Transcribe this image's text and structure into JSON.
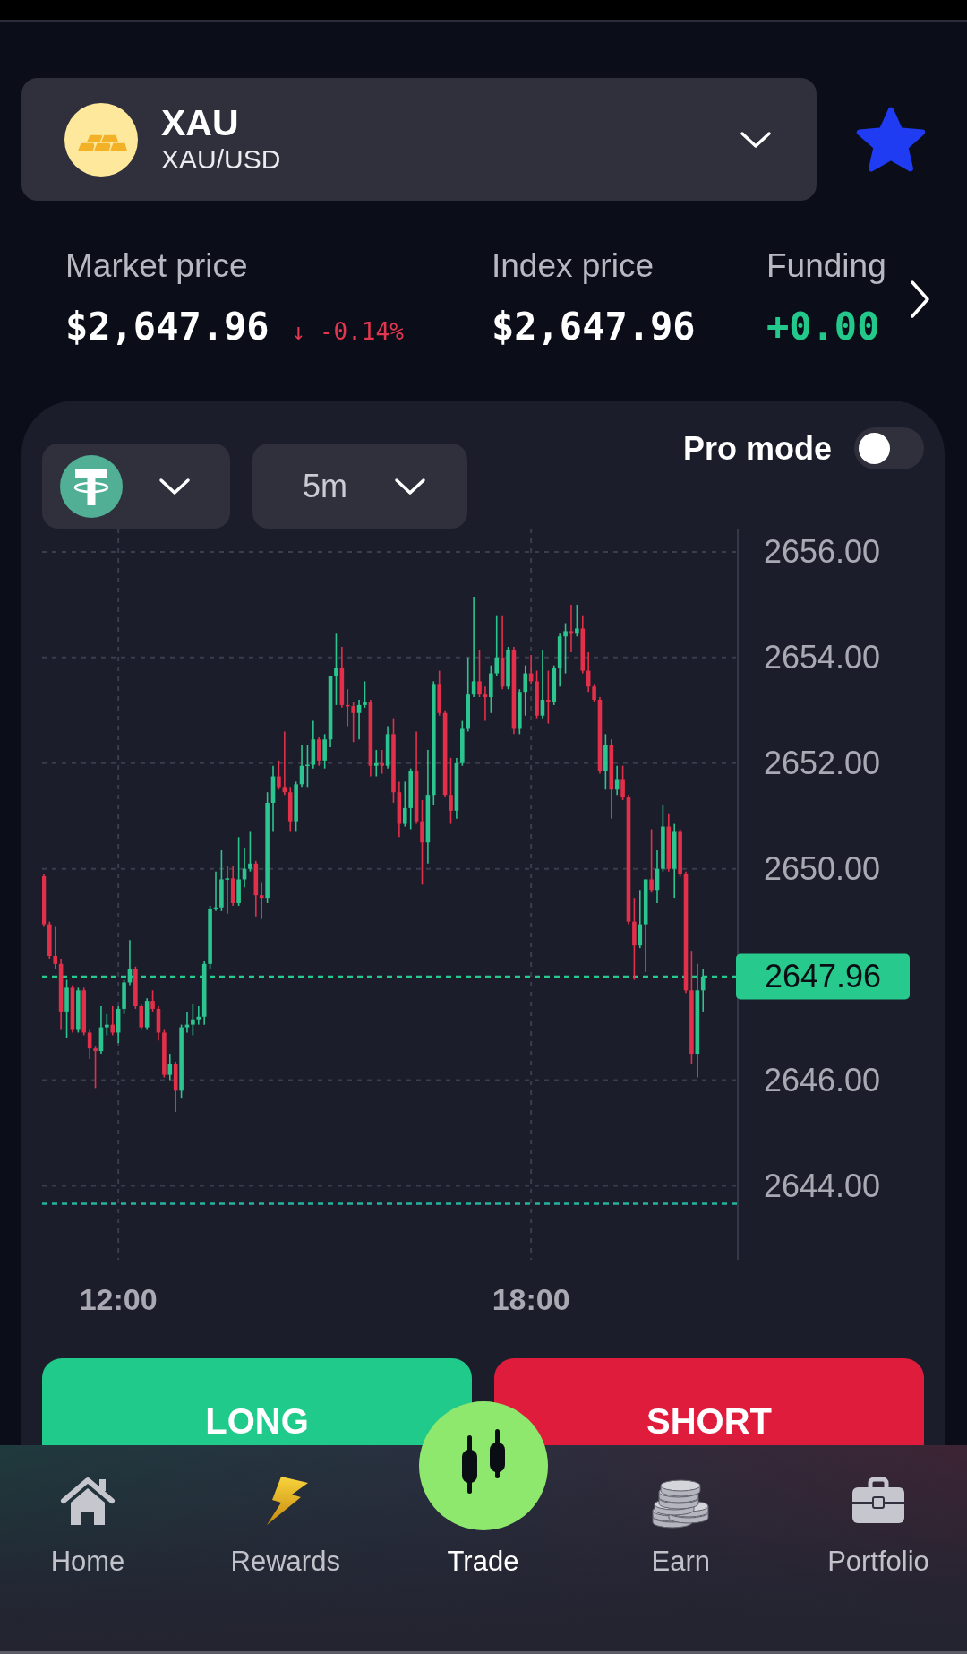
{
  "favorite": true,
  "asset_selector": {
    "symbol": "XAU",
    "pair": "XAU/USD"
  },
  "stats": [
    {
      "label": "Market price",
      "value": "$2,647.96",
      "value_positive": false,
      "change": "↓ -0.14%",
      "change_negative": true
    },
    {
      "label": "Index price",
      "value": "$2,647.96",
      "value_positive": false
    },
    {
      "label": "Funding",
      "value": "+0.00",
      "value_positive": true
    }
  ],
  "chart_panel": {
    "timeframe": "5m",
    "pro_mode": {
      "label": "Pro mode",
      "on": false
    },
    "chart_data": {
      "type": "candlestick",
      "grid": true,
      "xlim": [
        653.5,
        1259.5
      ],
      "ylim": [
        2642.6,
        2656.44
      ],
      "xticks": [
        {
          "value": 720,
          "label": "12:00"
        },
        {
          "value": 1080,
          "label": "18:00"
        }
      ],
      "yticks": [
        {
          "value": 2656,
          "label": "2656.00"
        },
        {
          "value": 2654,
          "label": "2654.00"
        },
        {
          "value": 2652,
          "label": "2652.00"
        },
        {
          "value": 2650,
          "label": "2650.00"
        },
        {
          "value": 2646,
          "label": "2646.00"
        },
        {
          "value": 2644,
          "label": "2644.00"
        }
      ],
      "x": [
        655,
        660,
        665,
        670,
        675,
        680,
        685,
        690,
        695,
        700,
        705,
        710,
        715,
        720,
        725,
        730,
        735,
        740,
        745,
        750,
        755,
        760,
        765,
        770,
        775,
        780,
        785,
        790,
        795,
        800,
        805,
        810,
        815,
        820,
        825,
        830,
        835,
        840,
        845,
        850,
        855,
        860,
        865,
        870,
        875,
        880,
        885,
        890,
        895,
        900,
        905,
        910,
        915,
        920,
        925,
        930,
        935,
        940,
        945,
        950,
        955,
        960,
        965,
        970,
        975,
        980,
        985,
        990,
        995,
        1000,
        1005,
        1010,
        1015,
        1020,
        1025,
        1030,
        1035,
        1040,
        1045,
        1050,
        1055,
        1060,
        1065,
        1070,
        1075,
        1080,
        1085,
        1090,
        1095,
        1100,
        1105,
        1110,
        1115,
        1120,
        1125,
        1130,
        1135,
        1140,
        1145,
        1150,
        1155,
        1160,
        1165,
        1170,
        1175,
        1180,
        1185,
        1190,
        1195,
        1200,
        1205,
        1210,
        1215,
        1220,
        1225,
        1230
      ],
      "ohlc": [
        [
          2649.86,
          2649.9,
          2648.9,
          2648.95
        ],
        [
          2648.95,
          2649.0,
          2648.3,
          2648.35
        ],
        [
          2648.35,
          2648.9,
          2648.1,
          2648.2
        ],
        [
          2648.2,
          2648.3,
          2646.95,
          2647.3
        ],
        [
          2647.3,
          2647.9,
          2646.8,
          2647.75
        ],
        [
          2647.75,
          2647.8,
          2646.9,
          2646.95
        ],
        [
          2646.95,
          2647.75,
          2646.9,
          2647.7
        ],
        [
          2647.7,
          2647.75,
          2646.85,
          2646.9
        ],
        [
          2646.9,
          2646.95,
          2646.4,
          2646.6
        ],
        [
          2646.6,
          2646.65,
          2645.85,
          2646.55
        ],
        [
          2646.55,
          2647.4,
          2646.5,
          2647.0
        ],
        [
          2647.0,
          2647.25,
          2646.85,
          2647.05
        ],
        [
          2647.05,
          2647.4,
          2646.85,
          2646.9
        ],
        [
          2646.9,
          2647.4,
          2646.7,
          2647.35
        ],
        [
          2647.35,
          2647.9,
          2647.25,
          2647.85
        ],
        [
          2647.85,
          2648.65,
          2647.8,
          2648.1
        ],
        [
          2648.1,
          2648.15,
          2647.35,
          2647.4
        ],
        [
          2647.4,
          2647.45,
          2646.95,
          2647.0
        ],
        [
          2647.0,
          2647.55,
          2646.95,
          2647.5
        ],
        [
          2647.5,
          2647.7,
          2647.3,
          2647.35
        ],
        [
          2647.35,
          2647.4,
          2646.75,
          2646.9
        ],
        [
          2646.9,
          2646.95,
          2646.05,
          2646.1
        ],
        [
          2646.1,
          2646.5,
          2646.0,
          2646.3
        ],
        [
          2646.3,
          2646.35,
          2645.4,
          2645.8
        ],
        [
          2645.8,
          2647.05,
          2645.65,
          2647.0
        ],
        [
          2647.0,
          2647.3,
          2646.9,
          2647.05
        ],
        [
          2647.05,
          2647.45,
          2646.85,
          2647.15
        ],
        [
          2647.15,
          2647.4,
          2647.05,
          2647.2
        ],
        [
          2647.2,
          2648.25,
          2647.05,
          2648.2
        ],
        [
          2648.2,
          2649.3,
          2648.1,
          2649.25
        ],
        [
          2649.25,
          2649.95,
          2649.2,
          2649.27
        ],
        [
          2649.27,
          2650.35,
          2649.2,
          2649.8
        ],
        [
          2649.8,
          2650.05,
          2649.15,
          2649.82
        ],
        [
          2649.82,
          2650.05,
          2649.3,
          2649.35
        ],
        [
          2649.35,
          2650.6,
          2649.3,
          2649.8
        ],
        [
          2649.8,
          2650.4,
          2649.65,
          2650.0
        ],
        [
          2650.0,
          2650.7,
          2649.95,
          2650.1
        ],
        [
          2650.1,
          2650.15,
          2649.1,
          2649.5
        ],
        [
          2649.5,
          2649.75,
          2649.05,
          2649.45
        ],
        [
          2649.45,
          2651.45,
          2649.35,
          2651.25
        ],
        [
          2651.25,
          2651.95,
          2650.7,
          2651.75
        ],
        [
          2651.75,
          2652.05,
          2651.5,
          2651.55
        ],
        [
          2651.55,
          2652.6,
          2651.4,
          2651.45
        ],
        [
          2651.45,
          2651.55,
          2650.7,
          2650.9
        ],
        [
          2650.9,
          2651.65,
          2650.7,
          2651.6
        ],
        [
          2651.6,
          2652.35,
          2651.55,
          2651.95
        ],
        [
          2651.95,
          2652.35,
          2651.55,
          2651.97
        ],
        [
          2651.97,
          2652.8,
          2651.9,
          2652.45
        ],
        [
          2652.45,
          2652.5,
          2651.95,
          2652.05
        ],
        [
          2652.05,
          2652.55,
          2651.9,
          2652.45
        ],
        [
          2652.45,
          2653.65,
          2652.3,
          2653.65
        ],
        [
          2653.65,
          2654.45,
          2653.1,
          2653.8
        ],
        [
          2653.8,
          2654.2,
          2653.05,
          2653.1
        ],
        [
          2653.1,
          2653.4,
          2652.7,
          2653.08
        ],
        [
          2653.08,
          2653.15,
          2652.4,
          2652.95
        ],
        [
          2652.95,
          2653.2,
          2652.45,
          2653.1
        ],
        [
          2653.1,
          2653.55,
          2653.05,
          2653.15
        ],
        [
          2653.15,
          2653.2,
          2651.75,
          2651.95
        ],
        [
          2651.95,
          2652.25,
          2651.75,
          2652.0
        ],
        [
          2652.0,
          2652.25,
          2651.8,
          2651.95
        ],
        [
          2651.95,
          2652.7,
          2651.9,
          2652.55
        ],
        [
          2652.55,
          2652.85,
          2651.25,
          2651.45
        ],
        [
          2651.45,
          2651.65,
          2650.6,
          2650.85
        ],
        [
          2650.85,
          2651.65,
          2650.8,
          2651.15
        ],
        [
          2651.15,
          2651.9,
          2650.75,
          2651.85
        ],
        [
          2651.85,
          2652.6,
          2650.85,
          2650.9
        ],
        [
          2650.9,
          2651.3,
          2649.7,
          2650.5
        ],
        [
          2650.5,
          2652.25,
          2650.1,
          2651.4
        ],
        [
          2651.4,
          2653.55,
          2651.2,
          2653.5
        ],
        [
          2653.5,
          2653.75,
          2652.9,
          2652.95
        ],
        [
          2652.95,
          2653.0,
          2651.35,
          2651.4
        ],
        [
          2651.4,
          2652.1,
          2650.85,
          2651.1
        ],
        [
          2651.1,
          2652.1,
          2650.95,
          2652.0
        ],
        [
          2652.0,
          2652.8,
          2651.95,
          2652.65
        ],
        [
          2652.65,
          2654.0,
          2652.6,
          2653.3
        ],
        [
          2653.3,
          2655.15,
          2653.25,
          2653.55
        ],
        [
          2653.55,
          2654.15,
          2653.25,
          2653.3
        ],
        [
          2653.3,
          2653.45,
          2652.8,
          2653.25
        ],
        [
          2653.25,
          2653.85,
          2652.95,
          2653.7
        ],
        [
          2653.7,
          2654.8,
          2653.65,
          2654.0
        ],
        [
          2654.0,
          2654.8,
          2653.4,
          2653.45
        ],
        [
          2653.45,
          2654.2,
          2653.4,
          2654.15
        ],
        [
          2654.15,
          2654.2,
          2652.55,
          2652.65
        ],
        [
          2652.65,
          2653.4,
          2652.55,
          2653.35
        ],
        [
          2653.35,
          2653.85,
          2652.9,
          2653.7
        ],
        [
          2653.7,
          2654.05,
          2653.5,
          2653.55
        ],
        [
          2653.55,
          2653.75,
          2652.85,
          2652.9
        ],
        [
          2652.9,
          2654.15,
          2652.85,
          2653.2
        ],
        [
          2653.2,
          2653.75,
          2652.75,
          2653.15
        ],
        [
          2653.15,
          2653.85,
          2653.1,
          2653.8
        ],
        [
          2653.8,
          2654.45,
          2653.45,
          2654.4
        ],
        [
          2654.4,
          2654.65,
          2653.7,
          2654.5
        ],
        [
          2654.5,
          2655.0,
          2654.1,
          2654.45
        ],
        [
          2654.45,
          2655.0,
          2654.4,
          2654.55
        ],
        [
          2654.55,
          2654.8,
          2653.7,
          2653.75
        ],
        [
          2653.75,
          2654.1,
          2653.35,
          2653.45
        ],
        [
          2653.45,
          2653.5,
          2653.15,
          2653.2
        ],
        [
          2653.2,
          2653.25,
          2651.8,
          2651.85
        ],
        [
          2651.85,
          2652.55,
          2651.5,
          2652.35
        ],
        [
          2652.35,
          2652.45,
          2650.95,
          2651.5
        ],
        [
          2651.5,
          2651.95,
          2651.4,
          2651.7
        ],
        [
          2651.7,
          2651.95,
          2651.3,
          2651.35
        ],
        [
          2651.35,
          2651.4,
          2648.95,
          2649.0
        ],
        [
          2649.0,
          2649.45,
          2647.9,
          2648.55
        ],
        [
          2648.55,
          2649.6,
          2648.5,
          2648.95
        ],
        [
          2648.95,
          2649.8,
          2648.05,
          2649.8
        ],
        [
          2649.8,
          2650.75,
          2649.55,
          2649.6
        ],
        [
          2649.6,
          2650.35,
          2649.35,
          2650.0
        ],
        [
          2650.0,
          2651.2,
          2649.95,
          2650.8
        ],
        [
          2650.8,
          2651.05,
          2649.95,
          2650.0
        ],
        [
          2650.0,
          2650.85,
          2649.45,
          2650.7
        ],
        [
          2650.7,
          2650.75,
          2649.85,
          2649.9
        ],
        [
          2649.9,
          2649.95,
          2647.65,
          2647.7
        ],
        [
          2647.7,
          2648.45,
          2646.3,
          2646.5
        ],
        [
          2646.5,
          2648.2,
          2646.05,
          2647.7
        ],
        [
          2647.7,
          2648.1,
          2647.3,
          2647.96
        ]
      ],
      "ref_lines": [
        {
          "axis": "y",
          "value": 2647.96,
          "label": "2647.96",
          "color": "#27c98d"
        },
        {
          "axis": "y",
          "value": 2643.66,
          "color": "#26b3a0"
        }
      ]
    }
  },
  "actions": [
    {
      "label": "LONG",
      "kind": "long"
    },
    {
      "label": "SHORT",
      "kind": "short"
    }
  ],
  "nav": [
    {
      "label": "Home",
      "kind": "tab",
      "selected": false
    },
    {
      "label": "Rewards",
      "kind": "tab",
      "selected": false
    },
    {
      "label": "Trade",
      "kind": "raised",
      "selected": true
    },
    {
      "label": "Earn",
      "kind": "tab",
      "selected": false
    },
    {
      "label": "Portfolio",
      "kind": "tab",
      "selected": false
    }
  ]
}
